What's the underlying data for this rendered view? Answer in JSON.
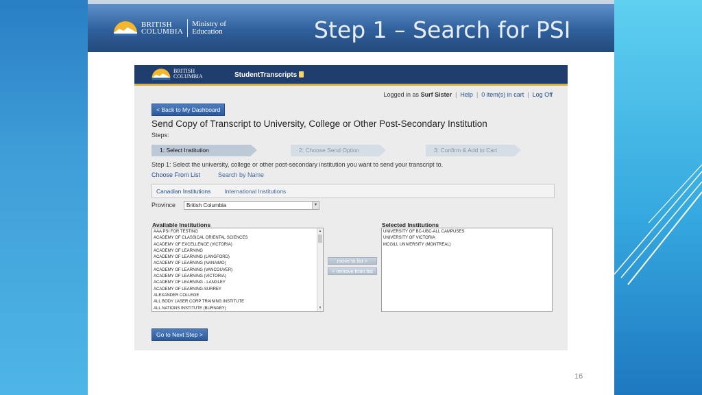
{
  "slide": {
    "title": "Step 1 – Search for PSI",
    "page_number": "16",
    "logo": {
      "line1": "BRITISH",
      "line2": "COLUMBIA",
      "ministry_line1": "Ministry of",
      "ministry_line2": "Education"
    }
  },
  "app": {
    "logo": {
      "line1": "BRITISH",
      "line2": "COLUMBIA"
    },
    "name": "StudentTranscripts",
    "user_bar": {
      "logged_in_prefix": "Logged in as",
      "user_name": "Surf Sister",
      "help": "Help",
      "cart": "0 item(s) in cart",
      "log_off": "Log Off"
    },
    "back_button": "< Back to My Dashboard",
    "heading": "Send Copy of Transcript to University, College or Other Post-Secondary Institution",
    "steps_label": "Steps:",
    "steps": [
      {
        "label": "1: Select Institution",
        "state": "active"
      },
      {
        "label": "2: Choose Send Option",
        "state": "inactive"
      },
      {
        "label": "3: Confirm & Add to Cart",
        "state": "inactive"
      }
    ],
    "instruction_prefix": "Step 1:",
    "instruction_text": "Select the university, college or other post-secondary institution you want to send your transcript to.",
    "choose_from_list": "Choose From List",
    "search_by_name": "Search by Name",
    "tabs": {
      "canadian": "Canadian Institutions",
      "international": "International Institutions"
    },
    "province_label": "Province",
    "province_value": "British Columbia",
    "available_label": "Available Institutions",
    "selected_label": "Selected Institutions",
    "available_institutions": [
      "AAA PSI FOR TESTING",
      "ACADEMY OF CLASSICAL ORIENTAL SCIENCES",
      "ACADEMY OF EXCELLENCE (VICTORIA)",
      "ACADEMY OF LEARNING",
      "ACADEMY OF LEARNING (LANGFORD)",
      "ACADEMY OF LEARNING (NANAIMO)",
      "ACADEMY OF LEARNING (VANCOUVER)",
      "ACADEMY OF LEARNING (VICTORIA)",
      "ACADEMY OF LEARNING - LANGLEY",
      "ACADEMY OF LEARNING-SURREY",
      "ALEXANDER COLLEGE",
      "ALL BODY LASER CORP TRAINING INSTITUTE",
      "ALL NATIONS INSTITUTE (BURNABY)"
    ],
    "selected_institutions": [
      "UNIVERSITY OF BC-UBC-ALL CAMPUSES",
      "UNIVERSITY OF VICTORIA",
      "MCGILL UNIVERSITY (MONTREAL)"
    ],
    "move_to_list": "move to list >",
    "remove_from_list": "< remove from list",
    "next_button": "Go to Next Step >"
  },
  "colors": {
    "header_dark": "#1f3d6d",
    "accent_gold": "#d7b046",
    "link_blue": "#1e4d8c"
  }
}
